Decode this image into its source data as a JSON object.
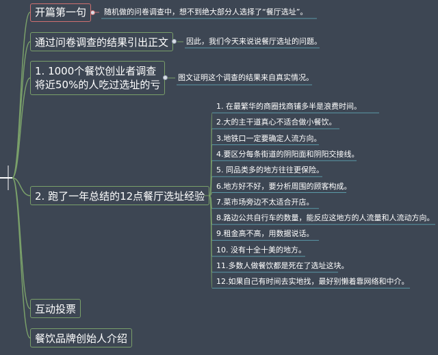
{
  "branches": [
    {
      "label": "开篇第一句",
      "note": "随机做的问卷调查中，想不到绝大部分人选择了“餐厅选址”。"
    },
    {
      "label": "通过问卷调查的结果引出正文",
      "note": "因此，我们今天来说说餐厅选址的问题。"
    },
    {
      "label_line1": "1. 1000个餐饮创业者调查",
      "label_line2": "将近50%的人吃过选址的亏",
      "note": "图文证明这个调查的结果来自真实情况。"
    },
    {
      "label": "2. 跑了一年总结的12点餐厅选址经验"
    },
    {
      "label": "互动投票"
    },
    {
      "label": "餐饮品牌创始人介绍"
    }
  ],
  "experiences": [
    "1. 在最繁华的商圈找商铺多半是浪费时间。",
    "2.大的主干道真心不适合做小餐饮。",
    "3.地铁口一定要确定人流方向。",
    "4.要区分每条街道的阴阳面和阴阳交接线。",
    "5. 同品类多的地方往往更保险。",
    "6.地方好不好，要分析周围的顾客构成。",
    "7.菜市场旁边不太适合开店。",
    "8.路边公共自行车的数量，能反应这地方的人流量和人流动方向。",
    "9.租金高不高，用数据说话。",
    "10. 没有十全十美的地方。",
    "11.多数人做餐饮都是死在了选址这块。",
    "12.如果自己有时间去实地找，最好别懒着靠网络和中介。"
  ],
  "colors": {
    "background": "#3d4653",
    "branch_border": "#7aa06a",
    "first_branch_border": "#d07070",
    "connector": "#7aa06a",
    "leaf_underline": "#5a9aa8",
    "root_line": "#ffffff"
  }
}
